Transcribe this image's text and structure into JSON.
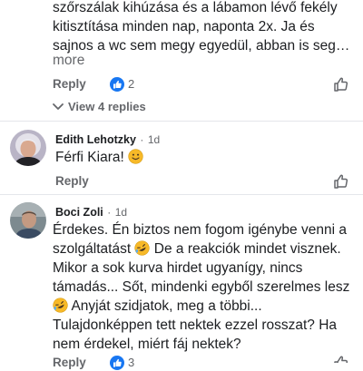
{
  "comment1": {
    "lines": [
      "szőrszálak kihúzása és a lábamon lévő fekély",
      "kitisztítása minden nap, naponta 2x. Ja és",
      "sajnos a wc sem megy egyedül, abban is seg…"
    ],
    "more": "more",
    "reply": "Reply",
    "like_count": "2",
    "view_replies": "View 4 replies"
  },
  "comment2": {
    "author": "Edith Lehotzky",
    "time": "1d",
    "dot": "·",
    "text": "Férfi Kiara!",
    "emoji": "slightly-smiling-face",
    "reply": "Reply"
  },
  "comment3": {
    "author": "Boci Zoli",
    "time": "1d",
    "dot": "·",
    "lines": {
      "l1": "Érdekes. Én biztos nem fogom igénybe venni a",
      "l2a": "szolgáltatást",
      "l2b": " De a reakciók mindet visznek.",
      "l3": "Mikor a sok kurva hirdet ugyanígy, nincs",
      "l4": "támadás... Sőt, mindenki egyből szerelmes lesz",
      "l5": "  Anyját szidjatok, meg a többi...",
      "l6": "Tulajdonképpen tett nektek ezzel rosszat? Ha",
      "l7": "nem érdekel, miért fáj nektek?"
    },
    "emoji": "rolling-on-floor-laughing",
    "reply": "Reply",
    "like_count": "3"
  },
  "colors": {
    "like_blue": "#1877f2",
    "haha_yellow": "#f7b928",
    "muted": "#65676b"
  }
}
